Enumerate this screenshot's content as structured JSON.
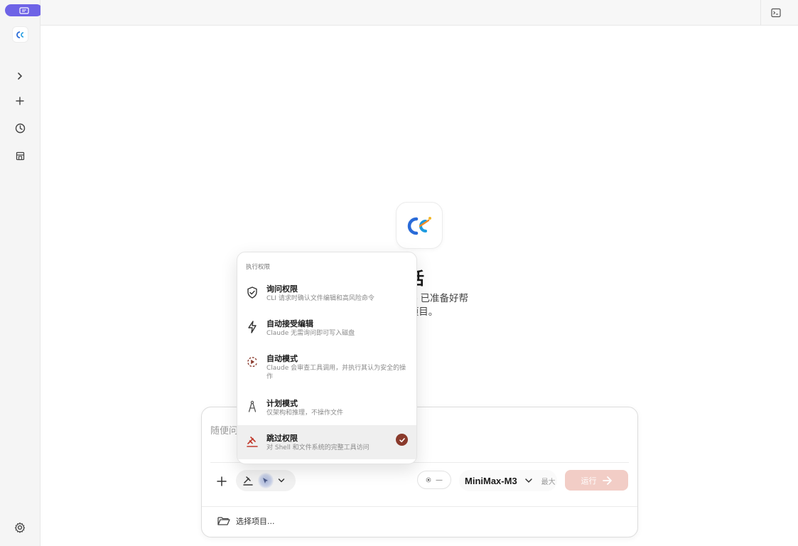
{
  "sidebar": {
    "items": [
      {
        "name": "expand",
        "icon": "chevron-right-icon"
      },
      {
        "name": "new",
        "icon": "plus-icon"
      },
      {
        "name": "history",
        "icon": "clock-icon"
      },
      {
        "name": "store",
        "icon": "store-icon"
      }
    ],
    "settings_icon": "gear-icon"
  },
  "hero": {
    "title": "建会话",
    "subtitle_line1": "话。Claude 已准备好帮",
    "subtitle_line2": "I设计你的项目。"
  },
  "composer": {
    "placeholder": "随便问",
    "effort_label": "—",
    "model": "MiniMax-M3",
    "model_tag": "最大",
    "run_label": "运行",
    "choose_project": "选择项目..."
  },
  "permissions_menu": {
    "heading": "执行权限",
    "items": [
      {
        "title": "询问权限",
        "desc": "CLI 请求时确认文件编辑和高风险命令",
        "icon": "shield-check-icon",
        "selected": false
      },
      {
        "title": "自动接受编辑",
        "desc": "Claude 无需询问即可写入磁盘",
        "icon": "lightning-icon",
        "selected": false
      },
      {
        "title": "自动模式",
        "desc": "Claude 会审查工具调用，并执行其认为安全的操作",
        "icon": "auto-cycle-icon",
        "selected": false
      },
      {
        "title": "计划模式",
        "desc": "仅架构和推理，不操作文件",
        "icon": "compass-icon",
        "selected": false
      },
      {
        "title": "跳过权限",
        "desc": "对 Shell 和文件系统的完整工具访问",
        "icon": "gavel-icon",
        "selected": true
      }
    ]
  },
  "colors": {
    "accent": "#6e63e6",
    "run_button": "#f2cdc6",
    "selected_check": "#8a3a2c",
    "danger_icon": "#c0392b"
  }
}
